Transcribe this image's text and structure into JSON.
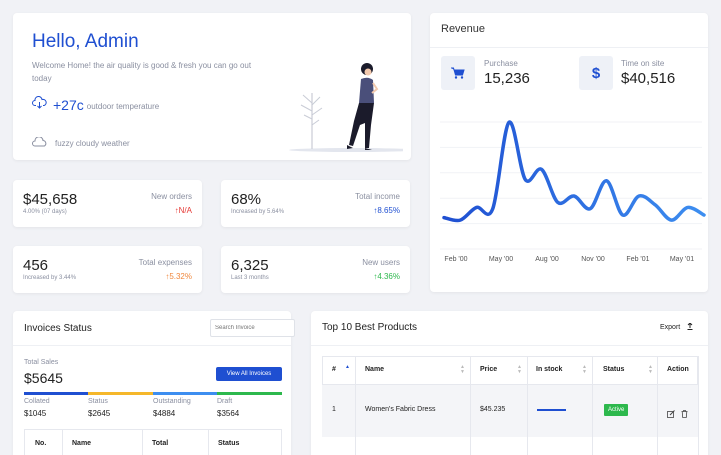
{
  "welcome": {
    "greeting": "Hello, Admin",
    "message": "Welcome Home! the air quality is good & fresh you can go out today",
    "temperature": "+27c",
    "temperature_label": "outdoor temperature",
    "weather": "fuzzy cloudy weather"
  },
  "revenue": {
    "title": "Revenue",
    "purchase_label": "Purchase",
    "purchase_value": "15,236",
    "time_label": "Time on site",
    "time_value": "$40,516",
    "chart_data": {
      "type": "line",
      "x_ticks": [
        "Feb '00",
        "May '00",
        "Aug '00",
        "Nov '00",
        "Feb '01",
        "May '01"
      ],
      "values": [
        20,
        18,
        28,
        27,
        95,
        50,
        58,
        32,
        37,
        27,
        49,
        22,
        37,
        30,
        18,
        28,
        22
      ],
      "color_dark": "#1f4fd1",
      "color_light": "#3d8ef0"
    }
  },
  "stats": [
    {
      "value": "$45,658",
      "sub": "4.00% (07 days)",
      "name": "New orders",
      "delta": "N/A",
      "delta_color": "#e53935"
    },
    {
      "value": "68%",
      "sub": "Increased by 5.64%",
      "name": "Total income",
      "delta": "8.65%",
      "delta_color": "#1f4fd1"
    },
    {
      "value": "456",
      "sub": "Increased by 3.44%",
      "name": "Total expenses",
      "delta": "5.32%",
      "delta_color": "#f0883e"
    },
    {
      "value": "6,325",
      "sub": "Last 3 months",
      "name": "New users",
      "delta": "4.36%",
      "delta_color": "#2db84d"
    }
  ],
  "invoices": {
    "title": "Invoices Status",
    "search_placeholder": "Search Invoice",
    "total_label": "Total Sales",
    "total_value": "$5645",
    "view_all": "View All Invoices",
    "segments": [
      {
        "label": "Collated",
        "value": "$1045",
        "color": "#1f4fd1"
      },
      {
        "label": "Status",
        "value": "$2645",
        "color": "#f5b72a"
      },
      {
        "label": "Outstanding",
        "value": "$4884",
        "color": "#3d8ef0"
      },
      {
        "label": "Draft",
        "value": "$3564",
        "color": "#2db84d"
      }
    ],
    "columns": [
      "No.",
      "Name",
      "Total",
      "Status"
    ]
  },
  "products": {
    "title": "Top 10 Best Products",
    "export": "Export",
    "columns": [
      "#",
      "Name",
      "Price",
      "In stock",
      "Status",
      "Action"
    ],
    "rows": [
      {
        "no": "1",
        "name": "Women's Fabric Dress",
        "price": "$45.235",
        "status": "Active"
      }
    ]
  }
}
